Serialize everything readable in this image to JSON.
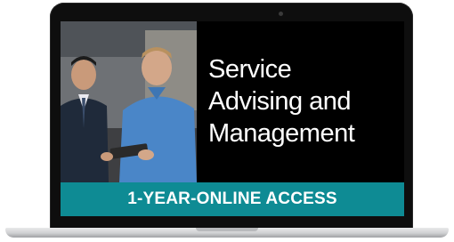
{
  "promo": {
    "title_lines": [
      "Service",
      "Advising and",
      "Management"
    ],
    "banner_text": "1-YEAR-ONLINE ACCESS"
  },
  "colors": {
    "banner": "#0e8b94",
    "screen_background": "#000000",
    "bezel": "#0e0e0e"
  },
  "icons": {
    "device": "laptop-icon"
  }
}
